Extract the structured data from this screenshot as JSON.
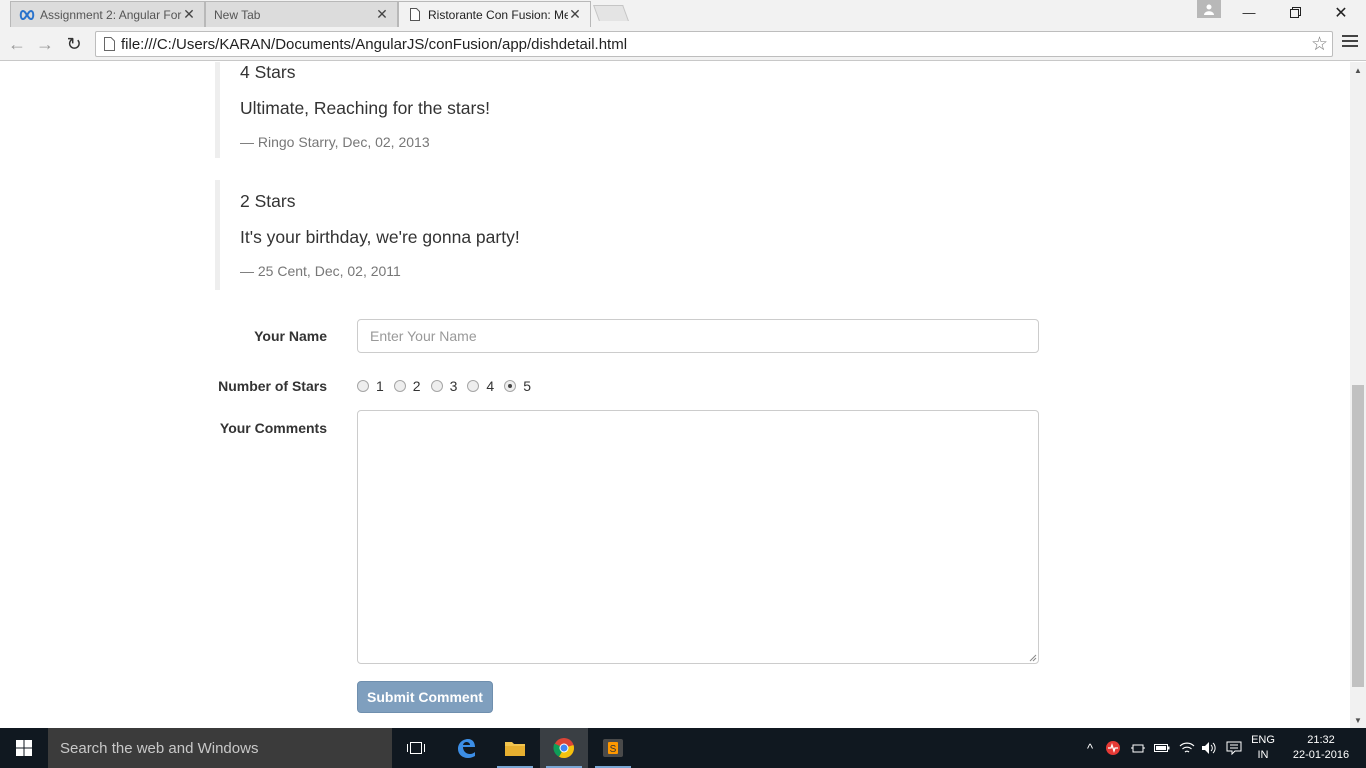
{
  "browser": {
    "tabs": [
      {
        "title": "Assignment 2: Angular For",
        "icon": "coursera-infinity-icon",
        "active": false
      },
      {
        "title": "New Tab",
        "icon": "",
        "active": false
      },
      {
        "title": "Ristorante Con Fusion: Me",
        "icon": "page-icon",
        "active": true
      }
    ],
    "url": "file:///C:/Users/KARAN/Documents/AngularJS/conFusion/app/dishdetail.html"
  },
  "comments": [
    {
      "rating": "4 Stars",
      "text": "Ultimate, Reaching for the stars!",
      "byline": "— Ringo Starry, Dec, 02, 2013"
    },
    {
      "rating": "2 Stars",
      "text": "It's your birthday, we're gonna party!",
      "byline": "— 25 Cent, Dec, 02, 2011"
    }
  ],
  "form": {
    "name_label": "Your Name",
    "name_placeholder": "Enter Your Name",
    "stars_label": "Number of Stars",
    "star_options": [
      "1",
      "2",
      "3",
      "4",
      "5"
    ],
    "selected_star": "5",
    "comments_label": "Your Comments",
    "submit_label": "Submit Comment"
  },
  "taskbar": {
    "search_placeholder": "Search the web and Windows",
    "language_line1": "ENG",
    "language_line2": "IN",
    "time": "21:32",
    "date": "22-01-2016"
  }
}
